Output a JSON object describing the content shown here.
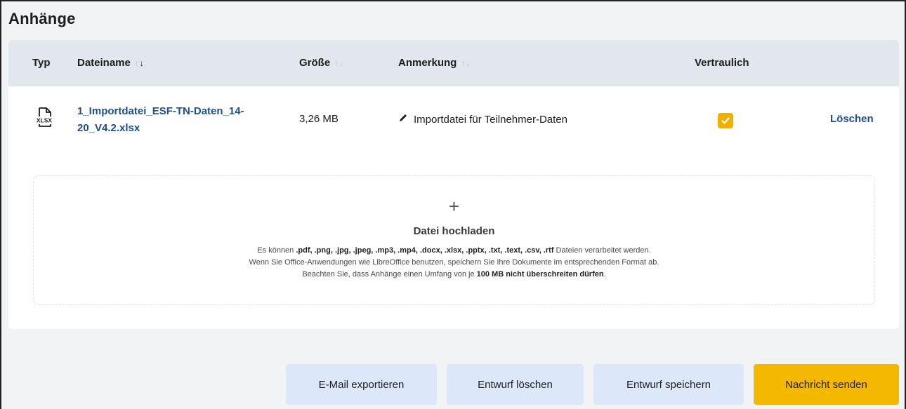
{
  "section": {
    "title": "Anhänge"
  },
  "table": {
    "columns": {
      "type": "Typ",
      "filename": "Dateiname",
      "size": "Größe",
      "note": "Anmerkung",
      "confidential": "Vertraulich"
    },
    "sort_arrows": {
      "up": "↑",
      "down": "↓"
    },
    "rows": [
      {
        "type_icon": "xlsx-file-icon",
        "type_label": "XLSX",
        "filename": "1_Importdatei_ESF-TN-Daten_14-20_V4.2.xlsx",
        "size": "3,26 MB",
        "note": "Importdatei für Teilnehmer-Daten",
        "confidential": true,
        "delete_label": "Löschen"
      }
    ]
  },
  "upload": {
    "icon": "plus-icon",
    "title": "Datei hochladen",
    "line1_prefix": "Es können ",
    "line1_formats": ".pdf, .png, .jpg, .jpeg, .mp3, .mp4, .docx, .xlsx, .pptx, .txt, .text, .csv, .rtf",
    "line1_suffix": " Dateien verarbeitet werden.",
    "line2": "Wenn Sie Office-Anwendungen wie LibreOffice benutzen, speichern Sie Ihre Dokumente im entsprechenden Format ab.",
    "line3_prefix": "Beachten Sie, dass Anhänge einen Umfang von je ",
    "line3_bold": "100 MB nicht überschreiten dürfen",
    "line3_suffix": "."
  },
  "actions": {
    "export": "E-Mail exportieren",
    "delete_draft": "Entwurf löschen",
    "save_draft": "Entwurf speichern",
    "send": "Nachricht senden"
  },
  "colors": {
    "primary_button": "#f5b800",
    "secondary_button": "#dce8f9",
    "link": "#1d4f91",
    "checkbox": "#f0b000",
    "table_header": "#e2e7ed"
  }
}
